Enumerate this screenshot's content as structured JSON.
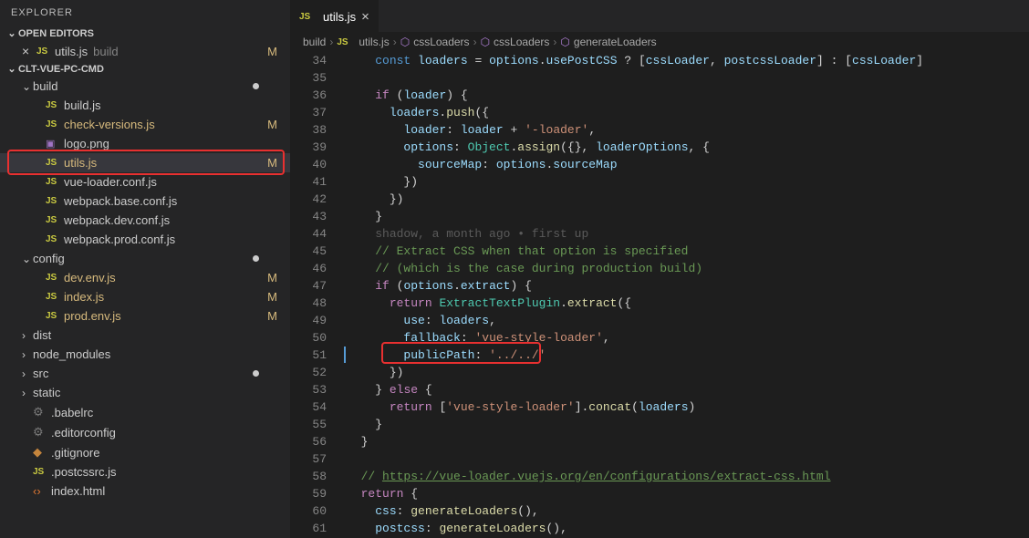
{
  "explorer": {
    "title": "EXPLORER",
    "openEditors": {
      "label": "OPEN EDITORS",
      "items": [
        {
          "icon": "JS",
          "name": "utils.js",
          "dir": "build",
          "status": "M"
        }
      ]
    },
    "project": {
      "name": "CLT-VUE-PC-CMD",
      "tree": [
        {
          "type": "folder",
          "name": "build",
          "expanded": true,
          "status": "dot",
          "depth": 1
        },
        {
          "type": "file",
          "icon": "JS",
          "name": "build.js",
          "depth": 2
        },
        {
          "type": "file",
          "icon": "JS",
          "name": "check-versions.js",
          "status": "M",
          "depth": 2
        },
        {
          "type": "file",
          "icon": "img",
          "name": "logo.png",
          "depth": 2
        },
        {
          "type": "file",
          "icon": "JS",
          "name": "utils.js",
          "status": "M",
          "active": true,
          "highlight": true,
          "depth": 2
        },
        {
          "type": "file",
          "icon": "JS",
          "name": "vue-loader.conf.js",
          "depth": 2
        },
        {
          "type": "file",
          "icon": "JS",
          "name": "webpack.base.conf.js",
          "depth": 2
        },
        {
          "type": "file",
          "icon": "JS",
          "name": "webpack.dev.conf.js",
          "depth": 2
        },
        {
          "type": "file",
          "icon": "JS",
          "name": "webpack.prod.conf.js",
          "depth": 2
        },
        {
          "type": "folder",
          "name": "config",
          "expanded": true,
          "status": "dot",
          "depth": 1
        },
        {
          "type": "file",
          "icon": "JS",
          "name": "dev.env.js",
          "status": "M",
          "depth": 2
        },
        {
          "type": "file",
          "icon": "JS",
          "name": "index.js",
          "status": "M",
          "depth": 2
        },
        {
          "type": "file",
          "icon": "JS",
          "name": "prod.env.js",
          "status": "M",
          "depth": 2
        },
        {
          "type": "folder",
          "name": "dist",
          "expanded": false,
          "depth": 1
        },
        {
          "type": "folder",
          "name": "node_modules",
          "expanded": false,
          "depth": 1
        },
        {
          "type": "folder",
          "name": "src",
          "expanded": false,
          "status": "dot",
          "depth": 1
        },
        {
          "type": "folder",
          "name": "static",
          "expanded": false,
          "depth": 1
        },
        {
          "type": "file",
          "icon": "gear",
          "name": ".babelrc",
          "depth": 1
        },
        {
          "type": "file",
          "icon": "gear",
          "name": ".editorconfig",
          "depth": 1
        },
        {
          "type": "file",
          "icon": "diamond",
          "name": ".gitignore",
          "depth": 1
        },
        {
          "type": "file",
          "icon": "JS",
          "name": ".postcssrc.js",
          "depth": 1
        },
        {
          "type": "file",
          "icon": "angle",
          "name": "index.html",
          "depth": 1
        }
      ]
    }
  },
  "editor": {
    "tab": {
      "icon": "JS",
      "name": "utils.js"
    },
    "breadcrumbs": [
      "build",
      "utils.js",
      "cssLoaders",
      "cssLoaders",
      "generateLoaders"
    ],
    "lines": [
      {
        "n": 34,
        "html": "    <span class='kw2'>const</span> <span class='var'>loaders</span> <span class='pn'>=</span> <span class='var'>options</span><span class='pn'>.</span><span class='var'>usePostCSS</span> <span class='pn'>? [</span><span class='var'>cssLoader</span><span class='pn'>,</span> <span class='var'>postcssLoader</span><span class='pn'>] : [</span><span class='var'>cssLoader</span><span class='pn'>]</span>"
      },
      {
        "n": 35,
        "html": ""
      },
      {
        "n": 36,
        "html": "    <span class='kw'>if</span> <span class='pn'>(</span><span class='var'>loader</span><span class='pn'>) {</span>"
      },
      {
        "n": 37,
        "html": "      <span class='var'>loaders</span><span class='pn'>.</span><span class='fn'>push</span><span class='pn'>({</span>"
      },
      {
        "n": 38,
        "html": "        <span class='var'>loader</span><span class='pn'>:</span> <span class='var'>loader</span> <span class='pn'>+</span> <span class='str'>'-loader'</span><span class='pn'>,</span>"
      },
      {
        "n": 39,
        "html": "        <span class='var'>options</span><span class='pn'>:</span> <span class='cls'>Object</span><span class='pn'>.</span><span class='fn'>assign</span><span class='pn'>({},</span> <span class='var'>loaderOptions</span><span class='pn'>, {</span>"
      },
      {
        "n": 40,
        "html": "          <span class='var'>sourceMap</span><span class='pn'>:</span> <span class='var'>options</span><span class='pn'>.</span><span class='var'>sourceMap</span>"
      },
      {
        "n": 41,
        "html": "        <span class='pn'>})</span>"
      },
      {
        "n": 42,
        "html": "      <span class='pn'>})</span>"
      },
      {
        "n": 43,
        "html": "    <span class='pn'>}</span>"
      },
      {
        "n": 44,
        "html": "    <span class='faded'>shadow, a month ago • first up</span>"
      },
      {
        "n": 45,
        "html": "    <span class='cmt'>// Extract CSS when that option is specified</span>"
      },
      {
        "n": 46,
        "html": "    <span class='cmt'>// (which is the case during production build)</span>"
      },
      {
        "n": 47,
        "html": "    <span class='kw'>if</span> <span class='pn'>(</span><span class='var'>options</span><span class='pn'>.</span><span class='var'>extract</span><span class='pn'>) {</span>"
      },
      {
        "n": 48,
        "html": "      <span class='kw'>return</span> <span class='cls'>ExtractTextPlugin</span><span class='pn'>.</span><span class='fn'>extract</span><span class='pn'>({</span>"
      },
      {
        "n": 49,
        "html": "        <span class='var'>use</span><span class='pn'>:</span> <span class='var'>loaders</span><span class='pn'>,</span>"
      },
      {
        "n": 50,
        "html": "        <span class='var'>fallback</span><span class='pn'>:</span> <span class='str'>'vue-style-loader'</span><span class='pn'>,</span>"
      },
      {
        "n": 51,
        "html": "        <span class='var'>publicPath</span><span class='pn'>:</span> <span class='str'>'../../'</span>"
      },
      {
        "n": 52,
        "html": "      <span class='pn'>})</span>"
      },
      {
        "n": 53,
        "html": "    <span class='pn'>}</span> <span class='kw'>else</span> <span class='pn'>{</span>"
      },
      {
        "n": 54,
        "html": "      <span class='kw'>return</span> <span class='pn'>[</span><span class='str'>'vue-style-loader'</span><span class='pn'>].</span><span class='fn'>concat</span><span class='pn'>(</span><span class='var'>loaders</span><span class='pn'>)</span>"
      },
      {
        "n": 55,
        "html": "    <span class='pn'>}</span>"
      },
      {
        "n": 56,
        "html": "  <span class='pn'>}</span>"
      },
      {
        "n": 57,
        "html": ""
      },
      {
        "n": 58,
        "html": "  <span class='cmt'>// </span><span class='cmt-link'>https://vue-loader.vuejs.org/en/configurations/extract-css.html</span>"
      },
      {
        "n": 59,
        "html": "  <span class='kw'>return</span> <span class='pn'>{</span>"
      },
      {
        "n": 60,
        "html": "    <span class='var'>css</span><span class='pn'>:</span> <span class='fn'>generateLoaders</span><span class='pn'>(),</span>"
      },
      {
        "n": 61,
        "html": "    <span class='var'>postcss</span><span class='pn'>:</span> <span class='fn'>generateLoaders</span><span class='pn'>(),</span>"
      }
    ]
  }
}
